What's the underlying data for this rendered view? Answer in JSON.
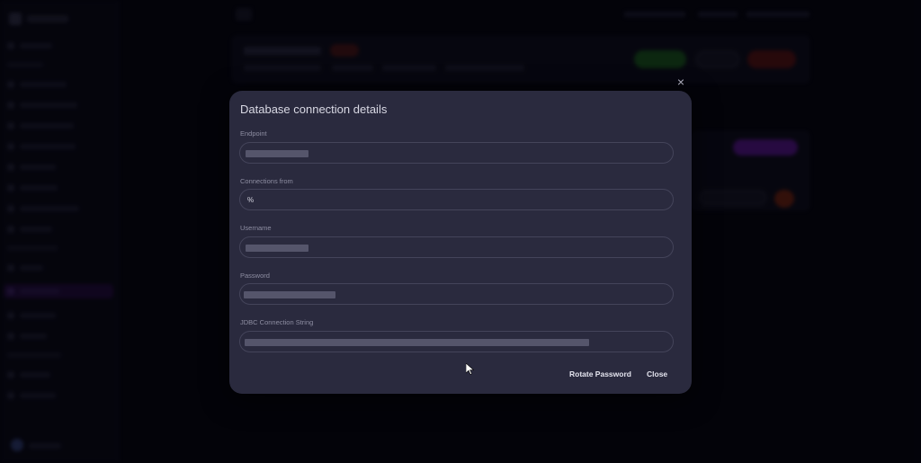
{
  "modal": {
    "title": "Database connection details",
    "fields": [
      {
        "label": "Endpoint",
        "value": ""
      },
      {
        "label": "Connections from",
        "value": "%"
      },
      {
        "label": "Username",
        "value": ""
      },
      {
        "label": "Password",
        "value": ""
      },
      {
        "label": "JDBC Connection String",
        "value": ""
      }
    ],
    "buttons": {
      "rotate_password": "Rotate Password",
      "close": "Close"
    },
    "close_icon": "×"
  },
  "colors": {
    "modal_bg": "#2a2a3e",
    "page_bg": "#05050f",
    "accent_purple": "#7a1fd6",
    "accent_green": "#2e7d32",
    "accent_red": "#8a1f1f"
  }
}
